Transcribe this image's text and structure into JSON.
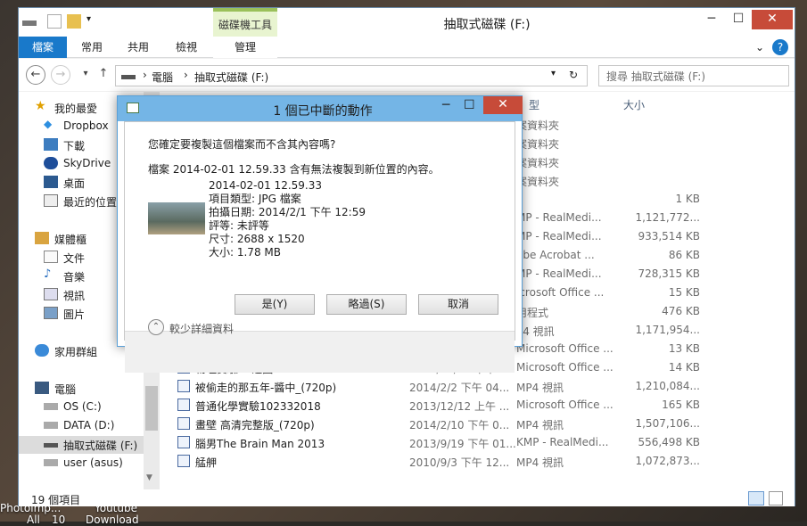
{
  "desktop": {
    "labels": [
      "Photolmp...",
      "Youtube",
      "All",
      "10",
      "Download"
    ]
  },
  "window": {
    "title": "抽取式磁碟 (F:)",
    "contextual_tab": "磁碟機工具",
    "tabs": [
      "檔案",
      "常用",
      "共用",
      "檢視",
      "管理"
    ],
    "address_parts": [
      "電腦",
      "抽取式磁碟 (F:)"
    ],
    "search_placeholder": "搜尋 抽取式磁碟 (F:)"
  },
  "nav": {
    "items": [
      {
        "label": "我的最愛",
        "icon": "star-icon"
      },
      {
        "label": "Dropbox",
        "icon": "dropbox-icon"
      },
      {
        "label": "下載",
        "icon": "download-icon"
      },
      {
        "label": "SkyDrive",
        "icon": "cloud-icon"
      },
      {
        "label": "桌面",
        "icon": "desktop-icon"
      },
      {
        "label": "最近的位置",
        "icon": "recent-icon"
      },
      {
        "label": "媒體櫃",
        "icon": "library-icon"
      },
      {
        "label": "文件",
        "icon": "document-icon"
      },
      {
        "label": "音樂",
        "icon": "music-icon"
      },
      {
        "label": "視訊",
        "icon": "video-icon"
      },
      {
        "label": "圖片",
        "icon": "picture-icon"
      },
      {
        "label": "家用群組",
        "icon": "homegroup-icon"
      },
      {
        "label": "電腦",
        "icon": "computer-icon"
      },
      {
        "label": "OS (C:)",
        "icon": "drive-icon"
      },
      {
        "label": "DATA (D:)",
        "icon": "drive-icon"
      },
      {
        "label": "抽取式磁碟 (F:)",
        "icon": "usb-drive-icon"
      },
      {
        "label": "user (asus)",
        "icon": "network-drive-icon"
      }
    ]
  },
  "columns": {
    "type_partial": "型",
    "size": "大小"
  },
  "files": [
    {
      "name": "",
      "date": "",
      "type": "案資料夾",
      "size": ""
    },
    {
      "name": "",
      "date": "",
      "type": "案資料夾",
      "size": ""
    },
    {
      "name": "",
      "date": "",
      "type": "案資料夾",
      "size": ""
    },
    {
      "name": "",
      "date": "",
      "type": "案資料夾",
      "size": ""
    },
    {
      "name": "",
      "date": "",
      "type": "",
      "size": "1 KB"
    },
    {
      "name": "",
      "date": "",
      "type": "MP - RealMedi...",
      "size": "1,121,772..."
    },
    {
      "name": "",
      "date": "",
      "type": "MP - RealMedi...",
      "size": "933,514 KB"
    },
    {
      "name": "",
      "date": "",
      "type": "obe Acrobat ...",
      "size": "86 KB"
    },
    {
      "name": "",
      "date": "",
      "type": "MP - RealMedi...",
      "size": "728,315 KB"
    },
    {
      "name": "",
      "date": "",
      "type": "icrosoft Office ...",
      "size": "15 KB"
    },
    {
      "name": "",
      "date": "",
      "type": "用程式",
      "size": "476 KB"
    },
    {
      "name": "",
      "date": "",
      "type": "P4 視訊",
      "size": "1,171,954..."
    },
    {
      "name": "物理11",
      "date": "2013/11/20 下午 ...",
      "type": "Microsoft Office ...",
      "size": "13 KB"
    },
    {
      "name": "物理實驗10之圖",
      "date": "2013/11/20 下午 ...",
      "type": "Microsoft Office ...",
      "size": "14 KB"
    },
    {
      "name": "被偷走的那五年-醬中_(720p)",
      "date": "2014/2/2 下午 04...",
      "type": "MP4 視訊",
      "size": "1,210,084..."
    },
    {
      "name": "普通化學實驗102332018",
      "date": "2013/12/12 上午 ...",
      "type": "Microsoft Office ...",
      "size": "165 KB"
    },
    {
      "name": "畫壁 高清完整版_(720p)",
      "date": "2014/2/10 下午 0...",
      "type": "MP4 視訊",
      "size": "1,507,106..."
    },
    {
      "name": "腦男The Brain Man 2013",
      "date": "2013/9/19 下午 01...",
      "type": "KMP - RealMedi...",
      "size": "556,498 KB"
    },
    {
      "name": "艋舺",
      "date": "2010/9/3 下午 12...",
      "type": "MP4 視訊",
      "size": "1,072,873..."
    }
  ],
  "status": {
    "count": "19 個項目"
  },
  "dialog": {
    "title": "1 個已中斷的動作",
    "question": "您確定要複製這個檔案而不含其內容嗎?",
    "message": "檔案 2014-02-01 12.59.33 含有無法複製到新位置的內容。",
    "file_name": "2014-02-01 12.59.33",
    "item_type": "項目類型: JPG 檔案",
    "date_taken": "拍攝日期: 2014/2/1 下午 12:59",
    "rating": "評等: 未評等",
    "dimensions": "尺寸: 2688 x 1520",
    "size": "大小: 1.78 MB",
    "yes": "是(Y)",
    "skip": "略過(S)",
    "cancel": "取消",
    "details_toggle": "較少詳細資料"
  }
}
